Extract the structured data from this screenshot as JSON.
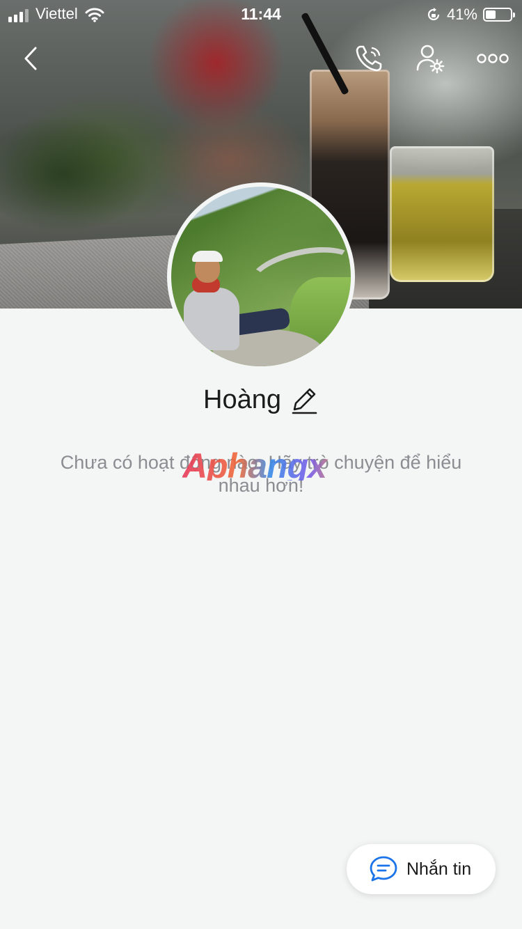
{
  "status_bar": {
    "carrier": "Viettel",
    "time": "11:44",
    "battery_text": "41%",
    "battery_level": 0.41
  },
  "icons": {
    "back": "chevron-left-icon",
    "call": "phone-icon",
    "profile_settings": "user-gear-icon",
    "more": "more-dots-icon",
    "edit": "pencil-icon",
    "chat": "chat-bubble-icon"
  },
  "profile": {
    "name": "Hoàng"
  },
  "activity": {
    "empty_message": "Chưa có hoạt động nào. Hãy trò chuyện để hiểu nhau hơn!"
  },
  "watermark": {
    "text": "Aphangx"
  },
  "message_button": {
    "label": "Nhắn tin"
  },
  "colors": {
    "background": "#f4f5f5",
    "accent": "#1a73e8",
    "muted_text": "#8a8d91"
  }
}
